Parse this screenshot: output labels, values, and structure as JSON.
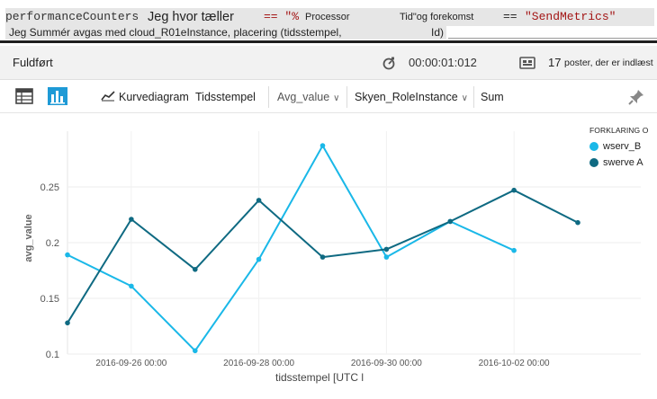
{
  "query": {
    "line1": {
      "table": "performanceCounters",
      "where": "Jeg hvor tæller",
      "op1": "== \"%",
      "counter": "Processor",
      "time_and": "Tid\"og forekomst",
      "op2": "==",
      "value": "\"SendMetrics\""
    },
    "line2": {
      "text": "Jeg Summér avgas med cloud_R01eInstance, placering (tidsstempel,",
      "tail": "Id)"
    }
  },
  "status": {
    "label": "Fuldført",
    "elapsed": "00:00:01:012",
    "count": "17",
    "records_label": "poster, der er indlæst"
  },
  "toolbar": {
    "table_icon": "table-icon",
    "chart_icon": "bar-chart-icon",
    "chart_type_label": "Kurvediagram",
    "x_label": "Tidsstempel",
    "y_label": "Avg_value",
    "split_label": "Skyen_RoleInstance",
    "agg_label": "Sum",
    "pin_icon": "pin-icon"
  },
  "colors": {
    "series_light": "#1ab8e8",
    "series_dark": "#0f6a82"
  },
  "chart_data": {
    "type": "line",
    "xlabel": "tidsstempel [UTC l",
    "ylabel": "avg_value",
    "ylim": [
      0.1,
      0.3
    ],
    "xlim": [
      "2016-09-25",
      "2016-10-03"
    ],
    "yticks": [
      "0.1",
      "0.15",
      "0.2",
      "0.25"
    ],
    "xticks": [
      "2016-09-26 00:00",
      "2016-09-28 00:00",
      "2016-09-30 00:00",
      "2016-10-02 00:00"
    ],
    "legend": {
      "title": "FORKLARING O",
      "position": "right"
    },
    "series": [
      {
        "name": "wserv_B",
        "color": "#1ab8e8",
        "points": [
          [
            "2016-09-25",
            0.189
          ],
          [
            "2016-09-26",
            0.161
          ],
          [
            "2016-09-27",
            0.103
          ],
          [
            "2016-09-28",
            0.185
          ],
          [
            "2016-09-29",
            0.287
          ],
          [
            "2016-09-30",
            0.187
          ],
          [
            "2016-10-01",
            0.219
          ],
          [
            "2016-10-02",
            0.193
          ]
        ]
      },
      {
        "name": "swerve A",
        "color": "#0f6a82",
        "points": [
          [
            "2016-09-25",
            0.128
          ],
          [
            "2016-09-26",
            0.221
          ],
          [
            "2016-09-27",
            0.176
          ],
          [
            "2016-09-28",
            0.238
          ],
          [
            "2016-09-29",
            0.187
          ],
          [
            "2016-09-30",
            0.194
          ],
          [
            "2016-10-01",
            0.219
          ],
          [
            "2016-10-02",
            0.247
          ],
          [
            "2016-10-03",
            0.218
          ]
        ]
      }
    ]
  }
}
